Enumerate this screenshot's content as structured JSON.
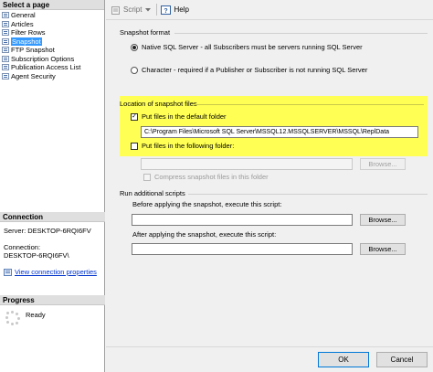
{
  "left": {
    "select_page_header": "Select a page",
    "pages": [
      {
        "label": "General",
        "icon": "page-icon",
        "selected": false
      },
      {
        "label": "Articles",
        "icon": "page-icon",
        "selected": false
      },
      {
        "label": "Filter Rows",
        "icon": "page-icon",
        "selected": false
      },
      {
        "label": "Snapshot",
        "icon": "page-icon",
        "selected": true
      },
      {
        "label": "FTP Snapshot",
        "icon": "page-icon",
        "selected": false
      },
      {
        "label": "Subscription Options",
        "icon": "page-icon",
        "selected": false
      },
      {
        "label": "Publication Access List",
        "icon": "page-icon",
        "selected": false
      },
      {
        "label": "Agent Security",
        "icon": "page-icon",
        "selected": false
      }
    ],
    "connection_header": "Connection",
    "server_label": "Server: DESKTOP-6RQI6FV",
    "connection_label": "Connection:",
    "connection_value": "DESKTOP-6RQI6FV\\",
    "view_connection_link": "View connection properties",
    "progress_header": "Progress",
    "progress_status": "Ready"
  },
  "toolbar": {
    "script_label": "Script",
    "help_label": "Help"
  },
  "snapshot_format": {
    "title": "Snapshot format",
    "native_label": "Native SQL Server - all Subscribers must be servers running SQL Server",
    "character_label": "Character - required if a Publisher or Subscriber is not running SQL Server",
    "selected": "native"
  },
  "location": {
    "title": "Location of snapshot files",
    "default_folder_label": "Put files in the default folder",
    "default_folder_checked": true,
    "default_folder_path": "C:\\Program Files\\Microsoft SQL Server\\MSSQL12.MSSQLSERVER\\MSSQL\\ReplData",
    "following_folder_label": "Put files in the following folder:",
    "following_folder_checked": false,
    "following_folder_value": "",
    "browse_label": "Browse...",
    "compress_label": "Compress snapshot files in this folder"
  },
  "scripts": {
    "title": "Run additional scripts",
    "before_label": "Before applying the snapshot, execute this script:",
    "before_value": "",
    "after_label": "After applying the snapshot, execute this script:",
    "after_value": "",
    "browse_label": "Browse..."
  },
  "footer": {
    "ok_label": "OK",
    "cancel_label": "Cancel"
  },
  "colors": {
    "highlight": "#ffff54",
    "selection": "#3399ff",
    "link": "#0033cc"
  }
}
